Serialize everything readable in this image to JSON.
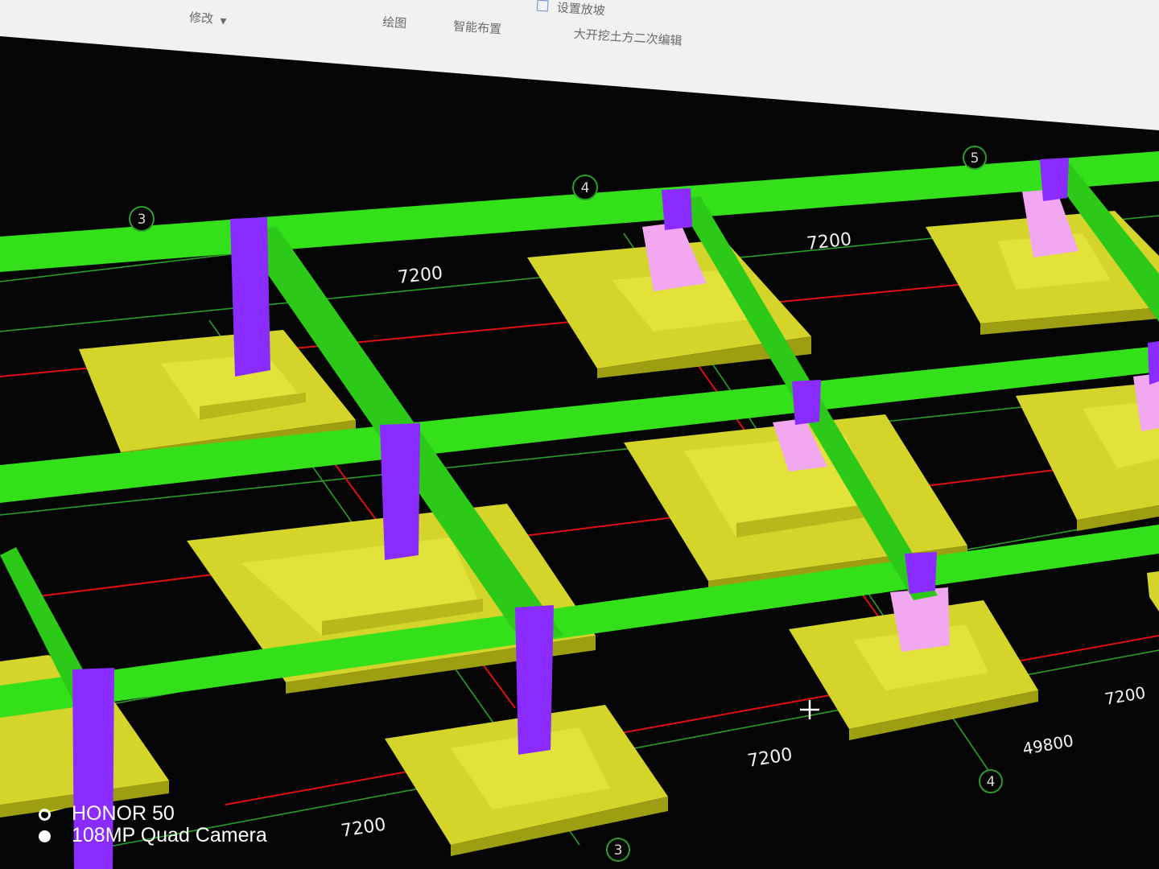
{
  "ribbon": {
    "modify_label": "修改",
    "modify_dropdown_icon": "chevron-down-icon",
    "draw_label": "绘图",
    "smart_layout_label": "智能布置",
    "set_slope_label": "设置放坡",
    "set_slope_icon": "slope-icon",
    "excavation_edit_label": "大开挖土方二次编辑"
  },
  "viewport": {
    "background_color": "#050505",
    "beam_color": "#33e01a",
    "column_color": "#8a2cff",
    "pedestal_color": "#f2a8f0",
    "footing_color": "#d9d92a",
    "gridline_color": "#2a9d2a",
    "axis_line_color": "#e01010",
    "axis_bubbles": [
      {
        "label": "3"
      },
      {
        "label": "4"
      },
      {
        "label": "5"
      },
      {
        "label": "4"
      },
      {
        "label": "3"
      }
    ],
    "dimensions": [
      {
        "label": "7200"
      },
      {
        "label": "7200"
      },
      {
        "label": "7200"
      },
      {
        "label": "7200"
      },
      {
        "label": "49800"
      },
      {
        "label": "7200"
      }
    ],
    "cursor_icon": "crosshair-icon"
  },
  "camera_watermark": {
    "device": "HONOR 50",
    "camera": "108MP Quad Camera"
  }
}
